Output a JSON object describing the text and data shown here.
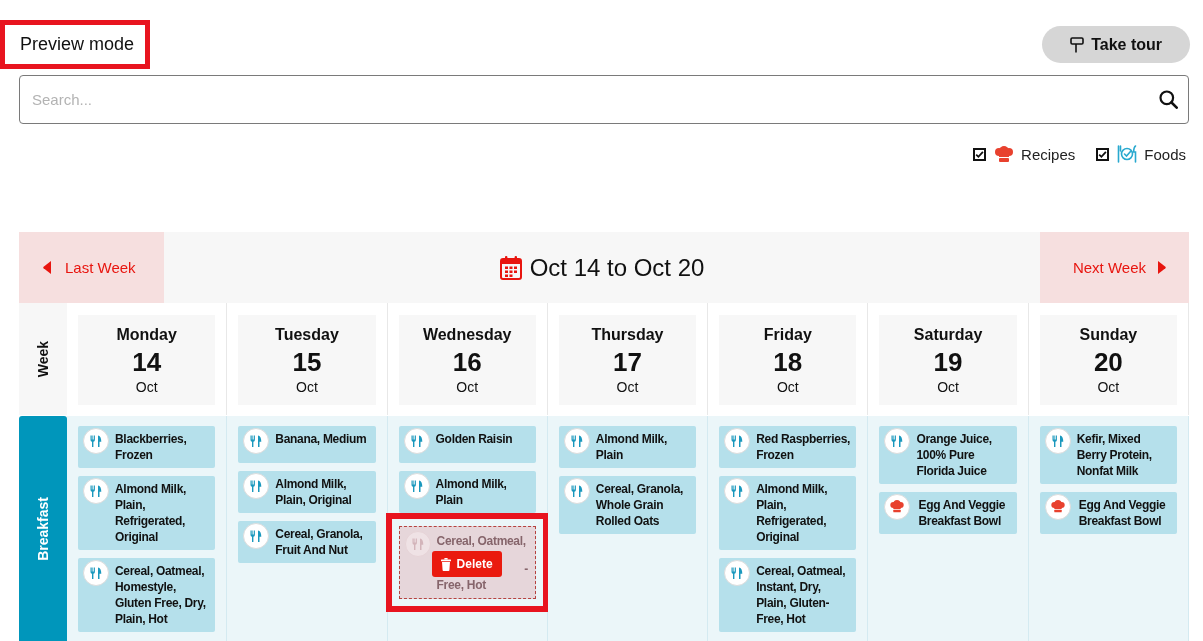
{
  "header": {
    "mode_label": {
      "text": "Preview mode",
      "highlighted": true
    },
    "tour_button": {
      "label": "Take tour"
    }
  },
  "search": {
    "placeholder": "Search..."
  },
  "filters": [
    {
      "kind": "recipe",
      "label": "Recipes",
      "checked": true
    },
    {
      "kind": "food",
      "label": "Foods",
      "checked": true
    }
  ],
  "week_nav": {
    "previous": "Last Week",
    "range": "Oct 14 to Oct 20",
    "next": "Next Week"
  },
  "week_label": "Week",
  "days": [
    {
      "name": "Monday",
      "number": "14",
      "month": "Oct"
    },
    {
      "name": "Tuesday",
      "number": "15",
      "month": "Oct"
    },
    {
      "name": "Wednesday",
      "number": "16",
      "month": "Oct"
    },
    {
      "name": "Thursday",
      "number": "17",
      "month": "Oct"
    },
    {
      "name": "Friday",
      "number": "18",
      "month": "Oct"
    },
    {
      "name": "Saturday",
      "number": "19",
      "month": "Oct"
    },
    {
      "name": "Sunday",
      "number": "20",
      "month": "Oct"
    }
  ],
  "meals": [
    {
      "label": "Breakfast",
      "columns": [
        {
          "items": [
            {
              "kind": "food",
              "name": "Blackberries, Frozen"
            },
            {
              "kind": "food",
              "name": "Almond Milk, Plain, Refrigerated, Original"
            },
            {
              "kind": "food",
              "name": "Cereal, Oatmeal, Homestyle, Gluten Free, Dry, Plain, Hot"
            }
          ]
        },
        {
          "items": [
            {
              "kind": "food",
              "name": "Banana, Medium"
            },
            {
              "kind": "food",
              "name": "Almond Milk, Plain, Original"
            },
            {
              "kind": "food",
              "name": "Cereal, Granola, Fruit And Nut"
            }
          ]
        },
        {
          "items": [
            {
              "kind": "food",
              "name": "Golden Raisin"
            },
            {
              "kind": "food",
              "name": "Almond Milk, Plain"
            },
            {
              "kind": "drag_preview",
              "fragments": [
                "Cereal, Oatmeal,",
                "-",
                "Free, Hot"
              ],
              "action": "Delete",
              "highlighted": true
            }
          ]
        },
        {
          "items": [
            {
              "kind": "food",
              "name": "Almond Milk, Plain"
            },
            {
              "kind": "food",
              "name": "Cereal, Granola, Whole Grain Rolled Oats"
            }
          ]
        },
        {
          "items": [
            {
              "kind": "food",
              "name": "Red Raspberries, Frozen"
            },
            {
              "kind": "food",
              "name": "Almond Milk, Plain, Refrigerated, Original"
            },
            {
              "kind": "food",
              "name": "Cereal, Oatmeal, Instant, Dry, Plain, Gluten-Free, Hot"
            }
          ]
        },
        {
          "items": [
            {
              "kind": "food",
              "name": "Orange Juice, 100% Pure Florida Juice"
            },
            {
              "kind": "recipe",
              "name": "Egg And Veggie Breakfast Bowl"
            }
          ]
        },
        {
          "items": [
            {
              "kind": "food",
              "name": "Kefir, Mixed Berry Protein, Nonfat Milk"
            },
            {
              "kind": "recipe",
              "name": "Egg And Veggie Breakfast Bowl"
            }
          ]
        }
      ]
    }
  ]
}
